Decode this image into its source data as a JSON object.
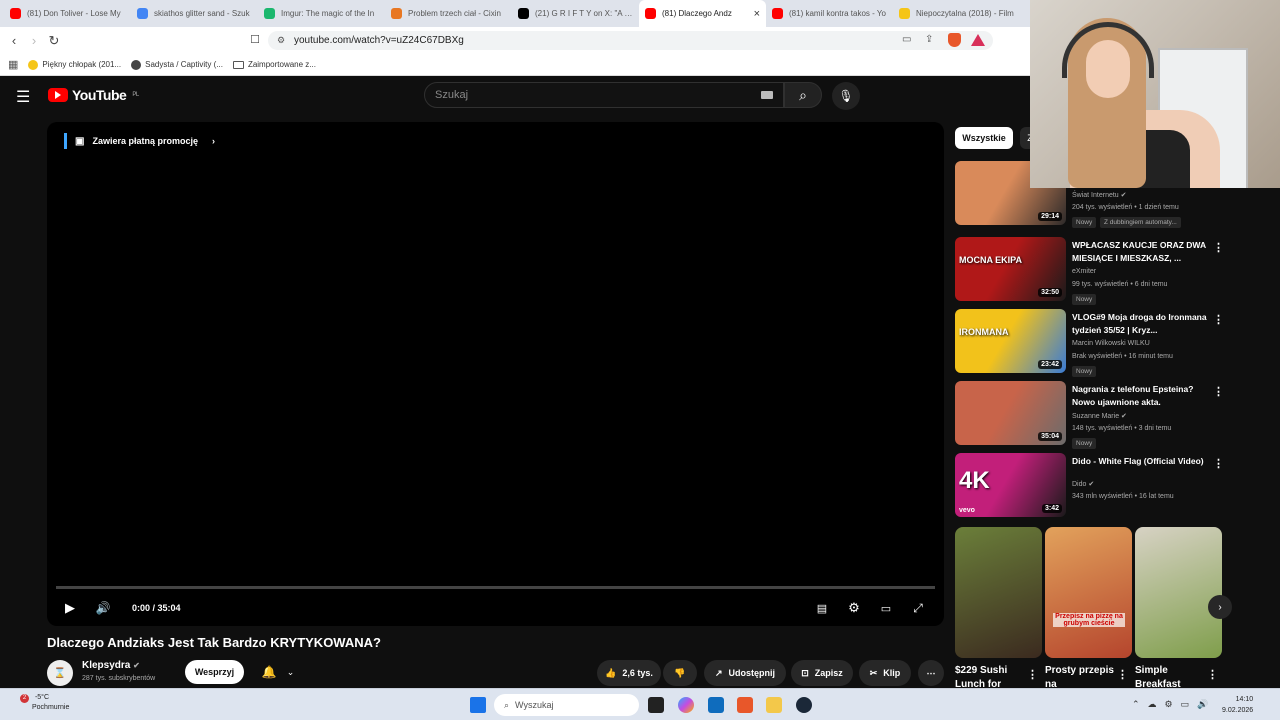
{
  "browser": {
    "tabs": [
      {
        "title": "(81) Don Toliver - Lose My",
        "color": "#ff0000",
        "icon": "youtube-icon"
      },
      {
        "title": "skiathos glitter sand - Szuk",
        "color": "#4285f4",
        "icon": "google-icon"
      },
      {
        "title": "Imgur: The magic of the In",
        "color": "#1bb76e",
        "icon": "imgur-icon"
      },
      {
        "title": "Problem trzech ciał - Cixin",
        "color": "#e87722",
        "icon": "book-icon"
      },
      {
        "title": "(21) G R I F T Y on X: \"A wo",
        "color": "#000000",
        "icon": "x-icon"
      },
      {
        "title": "(81) Dlaczego Andz",
        "color": "#ff0000",
        "icon": "youtube-icon",
        "active": true
      },
      {
        "title": "(81) kamil kontra takos - Yo",
        "color": "#ff0000",
        "icon": "youtube-icon"
      },
      {
        "title": "Niepoczytalna (2018) - Film",
        "color": "#f5c518",
        "icon": "filmweb-icon"
      }
    ],
    "url": "youtube.com/watch?v=uZ24C67DBXg",
    "bookmarks": [
      "Piękny chłopak (201...",
      "Sadysta / Captivity (...",
      "Zaimportowane z..."
    ]
  },
  "youtube": {
    "logo": "YouTube",
    "region": "PL",
    "search_placeholder": "Szukaj",
    "promo": "Zawiera płatną promocję",
    "time": "0:00 / 35:04",
    "title": "Dlaczego Andziaks Jest Tak Bardzo KRYTYKOWANA?",
    "channel": "Klepsydra",
    "subscribers": "287 tys. subskrybentów",
    "support": "Wesprzyj",
    "likes": "2,6 tys.",
    "share": "Udostępnij",
    "save": "Zapisz",
    "clip": "Klip",
    "chips": [
      "Wszystkie",
      "Z"
    ]
  },
  "recommendations": [
    {
      "title": "",
      "channel": "Świat Internetu",
      "meta": "204 tys. wyświetleń • 1 dzień temu",
      "badges": [
        "Nowy",
        "Z dubbingiem automaty..."
      ],
      "duration": "29:14",
      "colors": [
        "#d98a5a",
        "#2d2a2a"
      ]
    },
    {
      "title": "WPŁACASZ KAUCJE ORAZ DWA MIESIĄCE I MIESZKASZ, ...",
      "channel": "eXmiter",
      "meta": "99 tys. wyświetleń • 6 dni temu",
      "badges": [
        "Nowy"
      ],
      "duration": "32:50",
      "colors": [
        "#b01818",
        "#1a1a1a"
      ],
      "thumb_text": "MOCNA EKIPA"
    },
    {
      "title": "VLOG#9 Moja droga do Ironmana tydzień 35/52 | Kryz...",
      "channel": "Marcin Wilkowski WILKU",
      "meta": "Brak wyświetleń • 16 minut temu",
      "badges": [
        "Nowy"
      ],
      "duration": "23:42",
      "colors": [
        "#f2c21b",
        "#3a7bd5"
      ],
      "thumb_text": "IRONMANA"
    },
    {
      "title": "Nagrania z telefonu Epsteina? Nowo ujawnione akta.",
      "channel": "Suzanne Marie",
      "meta": "148 tys. wyświetleń • 3 dni temu",
      "badges": [
        "Nowy"
      ],
      "duration": "35:04",
      "colors": [
        "#c8644a",
        "#6b6b6b"
      ]
    },
    {
      "title": "Dido - White Flag (Official Video)",
      "channel": "Dido",
      "meta": "343 mln wyświetleń • 16 lat temu",
      "badges": [],
      "duration": "3:42",
      "colors": [
        "#c21f7a",
        "#1a1a1a"
      ],
      "thumb_text": "4K",
      "thumb_sub": "vevo"
    }
  ],
  "shorts": [
    {
      "title": "$229 Sushi Lunch for",
      "colors": [
        "#6b7f3a",
        "#3b2a1f"
      ]
    },
    {
      "title": "Prosty przepis na",
      "colors": [
        "#e2a25c",
        "#b5452d"
      ],
      "overlay": "Przepisz na pizzę na grubym cieście"
    },
    {
      "title": "Simple Breakfast",
      "colors": [
        "#d7d2c4",
        "#7f9e4b"
      ]
    }
  ],
  "taskbar": {
    "temp": "-5°C",
    "weather": "Pochmurnie",
    "search": "Wyszukaj",
    "time": "14:10",
    "date": "9.02.2026"
  }
}
